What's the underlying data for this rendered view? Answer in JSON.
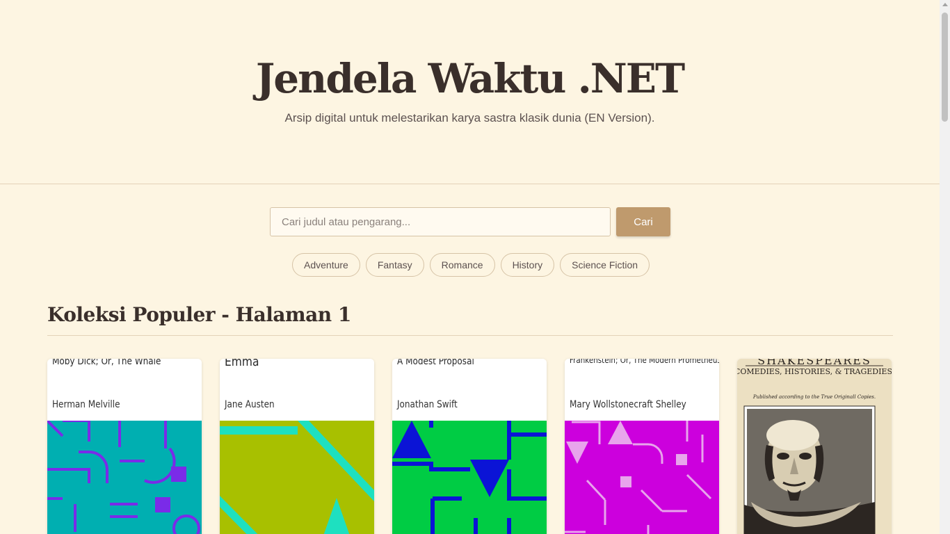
{
  "header": {
    "title": "Jendela Waktu .NET",
    "subtitle": "Arsip digital untuk melestarikan karya sastra klasik dunia (EN Version)."
  },
  "search": {
    "placeholder": "Cari judul atau pengarang...",
    "button_label": "Cari"
  },
  "genres": [
    "Adventure",
    "Fantasy",
    "Romance",
    "History",
    "Science Fiction"
  ],
  "section": {
    "title": "Koleksi Populer - Halaman 1"
  },
  "books": [
    {
      "title": "Moby Dick; Or, The Whale",
      "author": "Herman Melville",
      "cover_color": "#00afb1",
      "accent_color": "#7a2be8"
    },
    {
      "title": "Emma",
      "author": "Jane Austen",
      "cover_color": "#a8c000",
      "accent_color": "#1ee0c0"
    },
    {
      "title": "A Modest Proposal",
      "author": "Jonathan Swift",
      "cover_color": "#00cc44",
      "accent_color": "#0b14d6"
    },
    {
      "title": "Frankenstein; Or, The Modern Prometheus",
      "author": "Mary Wollstonecraft Shelley",
      "cover_color": "#cc00dd",
      "accent_color": "#e8a4ec"
    },
    {
      "title": "SHAKESPEARES",
      "subtitle": "COMEDIES, HISTORIES, & TRAGEDIES.",
      "imprint": "Published according to the True Originall Copies."
    }
  ]
}
